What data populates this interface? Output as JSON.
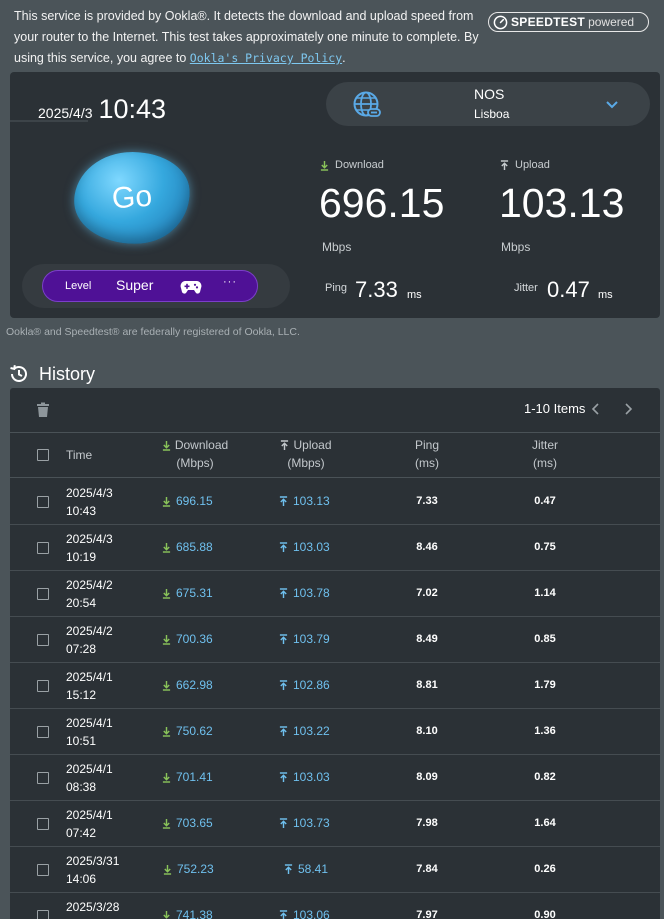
{
  "notice": {
    "text": "This service is provided by Ookla®. It detects the download and upload speed from your router to the Internet. This test takes approximately one minute to complete. By using this service, you agree to ",
    "link": "Ookla's Privacy Policy",
    "end": "."
  },
  "badge": {
    "brand": "SPEEDTEST",
    "powered": "powered"
  },
  "test": {
    "date": "2025/4/3",
    "time": "10:43",
    "go_label": "Go",
    "server": {
      "isp": "NOS",
      "city": "Lisboa"
    },
    "download": {
      "label": "Download",
      "value": "696.15",
      "unit": "Mbps"
    },
    "upload": {
      "label": "Upload",
      "value": "103.13",
      "unit": "Mbps"
    },
    "ping": {
      "label": "Ping",
      "value": "7.33",
      "unit": "ms"
    },
    "jitter": {
      "label": "Jitter",
      "value": "0.47",
      "unit": "ms"
    },
    "level": {
      "label": "Level",
      "value": "Super",
      "more": "···"
    }
  },
  "trademark": "Ookla® and Speedtest® are federally registered of Ookla, LLC.",
  "history": {
    "title": "History",
    "pager": "1-10 Items",
    "columns": {
      "time": "Time",
      "download": "Download",
      "download_unit": "(Mbps)",
      "upload": "Upload",
      "upload_unit": "(Mbps)",
      "ping": "Ping",
      "ping_unit": "(ms)",
      "jitter": "Jitter",
      "jitter_unit": "(ms)"
    },
    "rows": [
      {
        "date": "2025/4/3",
        "time": "10:43",
        "download": "696.15",
        "upload": "103.13",
        "ping": "7.33",
        "jitter": "0.47"
      },
      {
        "date": "2025/4/3",
        "time": "10:19",
        "download": "685.88",
        "upload": "103.03",
        "ping": "8.46",
        "jitter": "0.75"
      },
      {
        "date": "2025/4/2",
        "time": "20:54",
        "download": "675.31",
        "upload": "103.78",
        "ping": "7.02",
        "jitter": "1.14"
      },
      {
        "date": "2025/4/2",
        "time": "07:28",
        "download": "700.36",
        "upload": "103.79",
        "ping": "8.49",
        "jitter": "0.85"
      },
      {
        "date": "2025/4/1",
        "time": "15:12",
        "download": "662.98",
        "upload": "102.86",
        "ping": "8.81",
        "jitter": "1.79"
      },
      {
        "date": "2025/4/1",
        "time": "10:51",
        "download": "750.62",
        "upload": "103.22",
        "ping": "8.10",
        "jitter": "1.36"
      },
      {
        "date": "2025/4/1",
        "time": "08:38",
        "download": "701.41",
        "upload": "103.03",
        "ping": "8.09",
        "jitter": "0.82"
      },
      {
        "date": "2025/4/1",
        "time": "07:42",
        "download": "703.65",
        "upload": "103.73",
        "ping": "7.98",
        "jitter": "1.64"
      },
      {
        "date": "2025/3/31",
        "time": "14:06",
        "download": "752.23",
        "upload": "58.41",
        "ping": "7.84",
        "jitter": "0.26"
      },
      {
        "date": "2025/3/28",
        "time": "",
        "download": "741.38",
        "upload": "103.06",
        "ping": "7.97",
        "jitter": "0.90"
      }
    ]
  },
  "colors": {
    "accent": "#6fc0ee",
    "level_pill": "#4f1196",
    "panel": "#2b3136",
    "page_bg": "#4b5459",
    "download_arrow": "#8ac45a"
  }
}
